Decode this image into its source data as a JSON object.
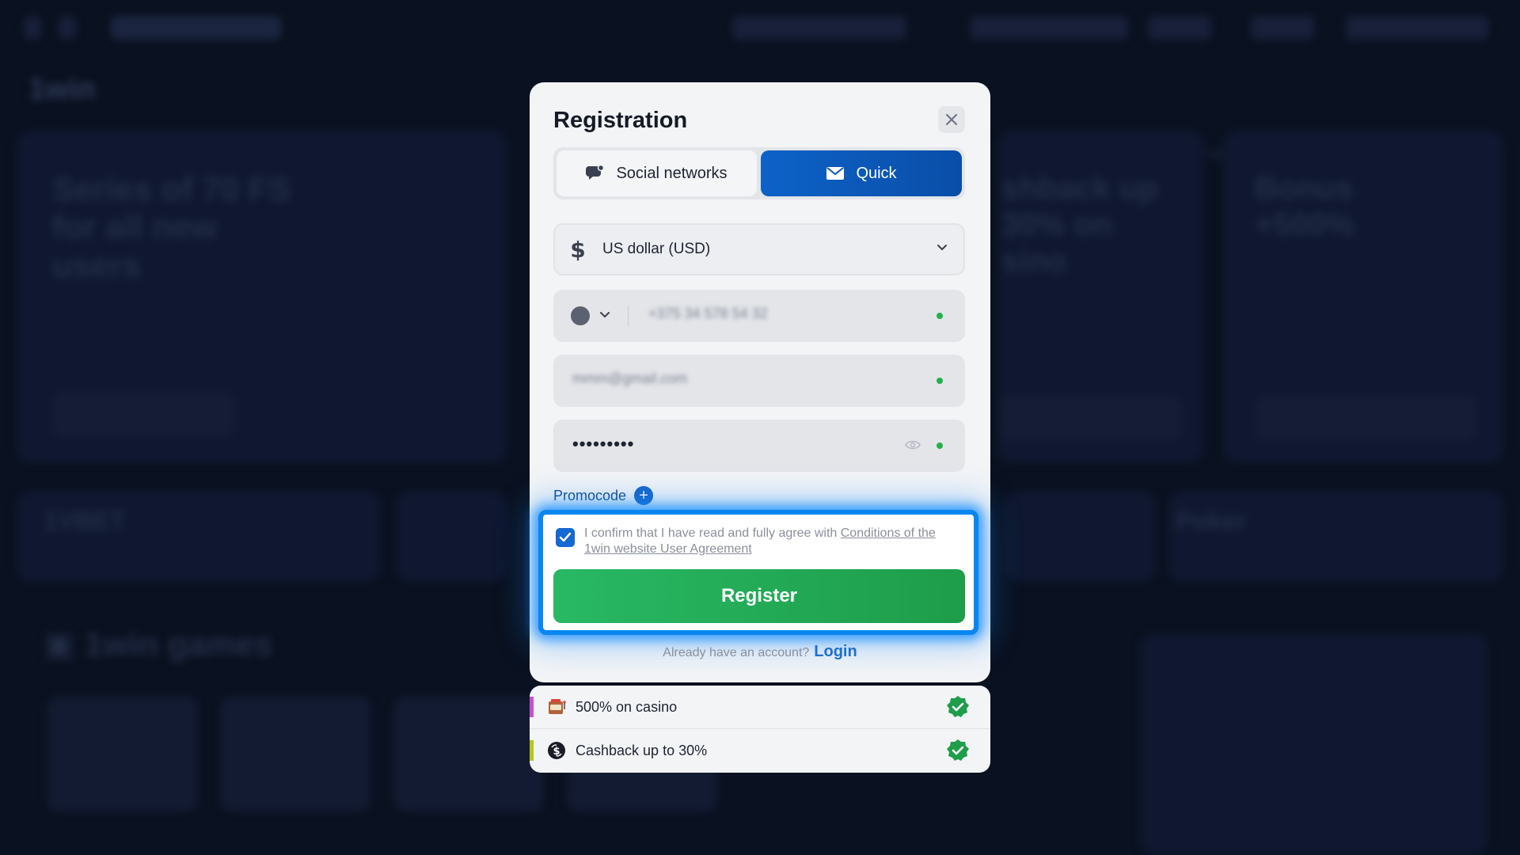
{
  "modal": {
    "title": "Registration",
    "tabs": [
      {
        "label": "Social networks",
        "active": false
      },
      {
        "label": "Quick",
        "active": true
      }
    ],
    "currency": {
      "value": "US dollar (USD)",
      "icon": "dollar-icon"
    },
    "phone": {
      "value": "+375 34 578 54 32"
    },
    "email": {
      "value": "mmm@gmail.com"
    },
    "password": {
      "value": "•••••••••"
    },
    "promocode_label": "Promocode",
    "agreement": {
      "checked": true,
      "text": "I confirm that I have read and fully agree with ",
      "link": "Conditions of the 1win website User Agreement"
    },
    "register_label": "Register",
    "login_prompt": "Already have an account?",
    "login_link": "Login"
  },
  "bonuses": [
    {
      "label": "500% on casino",
      "icon": "slot-machine-icon",
      "bar_color": "#c84fd0"
    },
    {
      "label": "Cashback up to 30%",
      "icon": "cashback-icon",
      "bar_color": "#b6c51a"
    }
  ],
  "colors": {
    "accent_blue": "#0d62c8",
    "register_green": "#28b864",
    "highlight": "#0a86f0",
    "success": "#23b04b"
  }
}
